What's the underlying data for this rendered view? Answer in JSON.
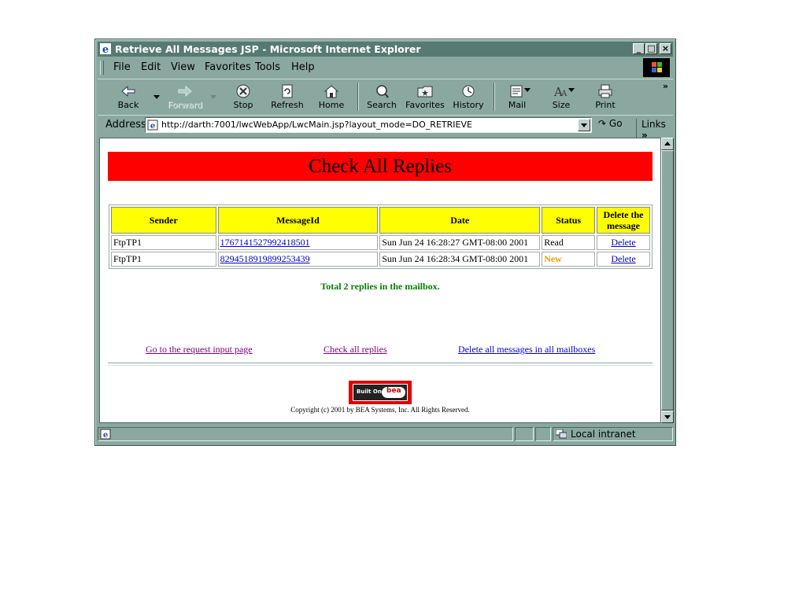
{
  "window": {
    "title": "Retrieve All Messages JSP - Microsoft Internet Explorer"
  },
  "menu": [
    "File",
    "Edit",
    "View",
    "Favorites",
    "Tools",
    "Help"
  ],
  "toolbar": {
    "back": "Back",
    "forward": "Forward",
    "stop": "Stop",
    "refresh": "Refresh",
    "home": "Home",
    "search": "Search",
    "favorites": "Favorites",
    "history": "History",
    "mail": "Mail",
    "size": "Size",
    "print": "Print"
  },
  "address": {
    "label": "Address",
    "url": "http://darth:7001/lwcWebApp/LwcMain.jsp?layout_mode=DO_RETRIEVE",
    "go": "Go",
    "links": "Links"
  },
  "page": {
    "heading": "Check All Replies",
    "table": {
      "headers": [
        "Sender",
        "MessageId",
        "Date",
        "Status",
        "Delete the message"
      ],
      "rows": [
        {
          "sender": "FtpTP1",
          "message_id": "1767141527992418501",
          "date": "Sun Jun 24 16:28:27 GMT-08:00 2001",
          "status": "Read",
          "delete": "Delete"
        },
        {
          "sender": "FtpTP1",
          "message_id": "8294518919899253439",
          "date": "Sun Jun 24 16:28:34 GMT-08:00 2001",
          "status": "New",
          "delete": "Delete"
        }
      ]
    },
    "total": "Total 2 replies in the mailbox.",
    "links": {
      "request_input": "Go to the request input page",
      "check_all": "Check all replies",
      "delete_all": "Delete all messages in all mailboxes"
    },
    "badge_text": "Built On",
    "badge_logo": "bea",
    "copyright": "Copyright (c) 2001 by BEA Systems, Inc. All Rights Reserved."
  },
  "status": {
    "zone": "Local intranet"
  },
  "colors": {
    "banner": "#ff0000",
    "header_cell": "#ffff00",
    "total_text": "#008000",
    "status_new": "#e8a000",
    "chrome": "#8aa8a0"
  }
}
